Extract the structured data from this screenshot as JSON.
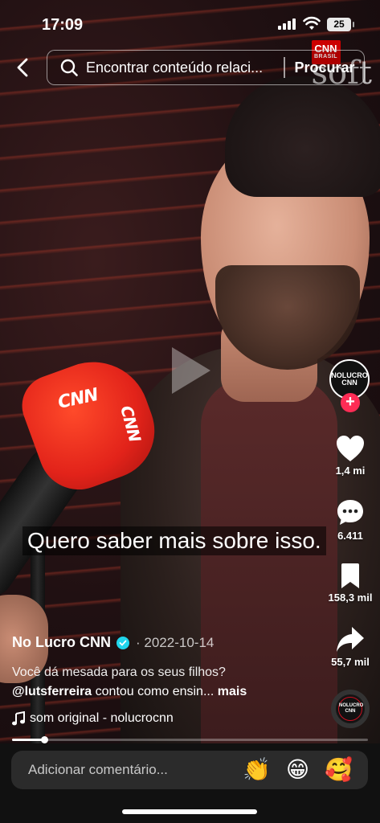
{
  "status_bar": {
    "time": "17:09",
    "battery": "25"
  },
  "top_bar": {
    "search_text": "Encontrar conteúdo relaci...",
    "search_button": "Procurar"
  },
  "watermark": {
    "brand": "CNN",
    "brand_sub": "BRASIL",
    "channel": "soft"
  },
  "video": {
    "mic_logo": "CNN",
    "caption": "Quero saber mais sobre isso."
  },
  "rail": {
    "avatar_line1": "NOLUCRO",
    "avatar_line2": "CNN",
    "likes": "1,4 mi",
    "comments": "6.411",
    "saves": "158,3 mil",
    "shares": "55,7 mil"
  },
  "post": {
    "author": "No Lucro CNN",
    "date": "2022-10-14",
    "description": "Você dá mesada para os seus filhos?",
    "mention": "@lutsferreira",
    "description_tail": " contou como ensin...",
    "more": "mais",
    "music": "som original - nolucrocnn",
    "disc_line1": "NOLUCRO",
    "disc_line2": "CNN",
    "progress": 0.09
  },
  "bottom_bar": {
    "comment_placeholder": "Adicionar comentário...",
    "emojis": [
      "👏",
      "😁",
      "🥰"
    ]
  },
  "colors": {
    "accent": "#fe2c55",
    "verified": "#20d5ec",
    "cnn_red": "#cc0000"
  }
}
